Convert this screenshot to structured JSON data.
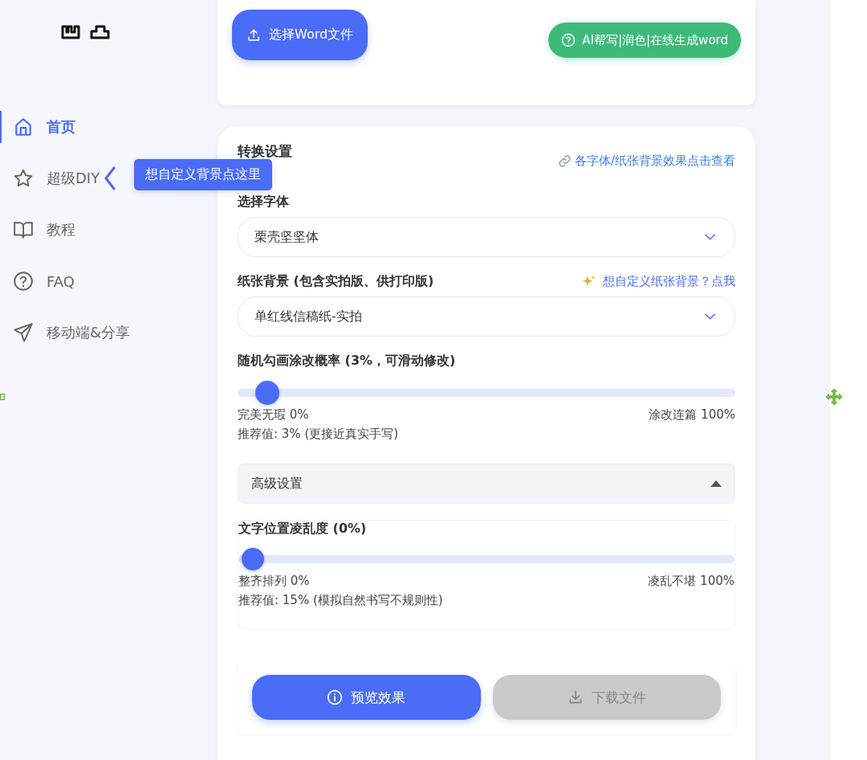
{
  "sidebar": {
    "items": [
      {
        "label": "首页",
        "selected": true
      },
      {
        "label": "超级DIY",
        "selected": false
      },
      {
        "label": "教程",
        "selected": false
      },
      {
        "label": "FAQ",
        "selected": false
      },
      {
        "label": "移动端&分享",
        "selected": false
      }
    ],
    "tooltip": "想自定义背景点这里"
  },
  "upload": {
    "select_button": "选择Word文件",
    "ai_button": "AI帮写|润色|在线生成word"
  },
  "settings": {
    "title": "转换设置",
    "font_link": "各字体/纸张背景效果点击查看",
    "font_label": "选择字体",
    "font_value": "栗壳坚坚体",
    "paper_label": "纸张背景 (包含实拍版、供打印版)",
    "paper_link": "想自定义纸张背景？点我",
    "paper_value": "单红线信稿纸-实拍",
    "scribble": {
      "label": "随机勾画涂改概率 (3%，可滑动修改)",
      "level": 0.03,
      "min_label": "完美无瑕 0%",
      "max_label": "涂改连篇 100%",
      "hint": "推荐值: 3% (更接近真实手写)"
    },
    "advanced": {
      "label": "高级设置",
      "expanded": true
    },
    "jitter": {
      "label": "文字位置凌乱度 (0%)",
      "level": 0,
      "min_label": "整齐排列 0%",
      "max_label": "凌乱不堪 100%",
      "hint": "推荐值: 15% (模拟自然书写不规则性)"
    },
    "preview_button": "预览效果",
    "download_button": {
      "label": "下载文件",
      "disabled": true
    }
  }
}
